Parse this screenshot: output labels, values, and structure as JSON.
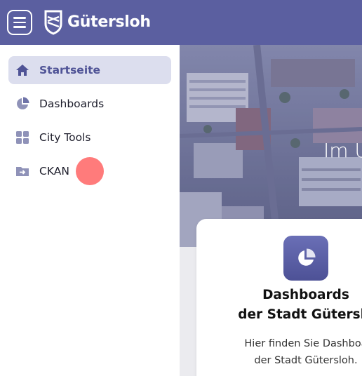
{
  "header": {
    "brand": "Gütersloh",
    "menu_icon": "menu-icon",
    "logo_icon": "city-logo-icon",
    "color": "#5b5fa0"
  },
  "sidebar": {
    "items": [
      {
        "label": "Startseite",
        "icon": "home-icon",
        "active": true
      },
      {
        "label": "Dashboards",
        "icon": "pie-chart-icon",
        "active": false
      },
      {
        "label": "City Tools",
        "icon": "grid-icon",
        "active": false
      },
      {
        "label": "CKAN",
        "icon": "folder-arrow-icon",
        "active": false
      }
    ],
    "active_bg": "#dcdeee",
    "active_color": "#4f5396"
  },
  "main": {
    "hero_title": "Im U",
    "card": {
      "icon": "pie-chart-icon",
      "title_line1": "Dashboards",
      "title_line2": "der Stadt Güterslo",
      "text_line1": "Hier finden Sie Dashboa",
      "text_line2": "der Stadt Gütersloh."
    }
  }
}
